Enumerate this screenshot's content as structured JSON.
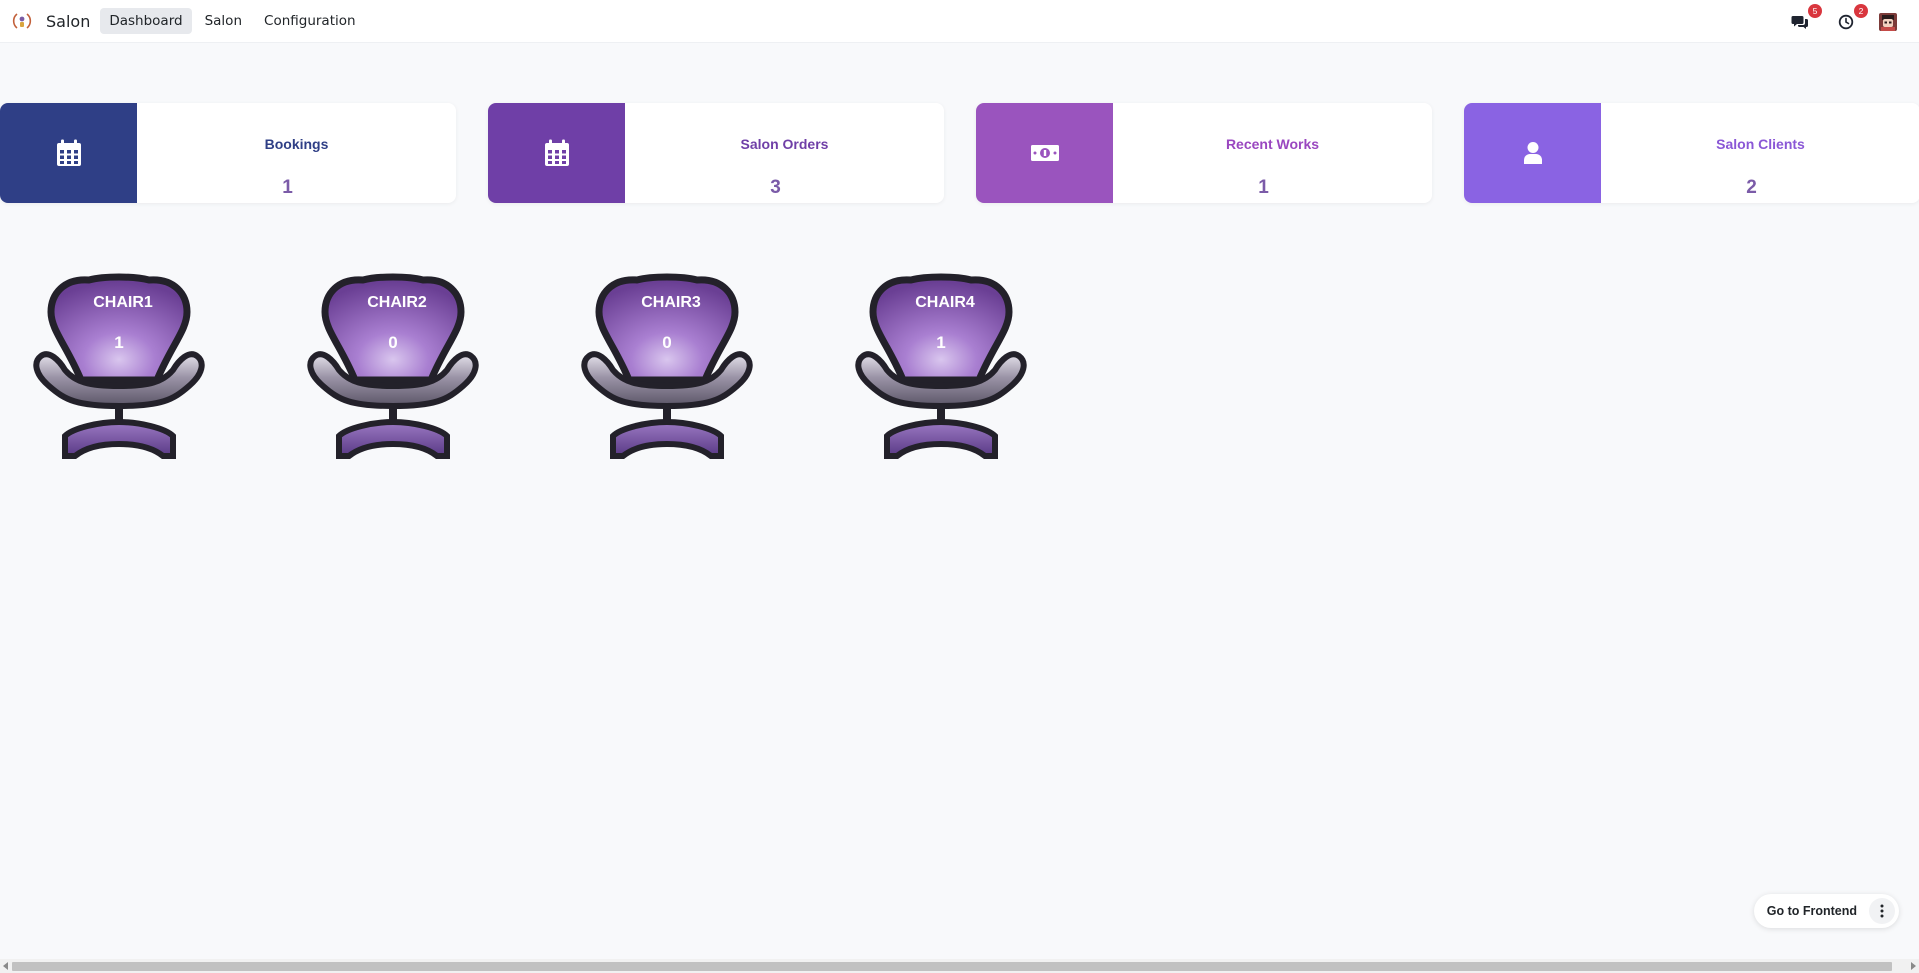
{
  "app": {
    "brand": "Salon"
  },
  "nav": {
    "items": [
      {
        "label": "Dashboard",
        "active": true
      },
      {
        "label": "Salon",
        "active": false
      },
      {
        "label": "Configuration",
        "active": false
      }
    ]
  },
  "systray": {
    "messages_badge": "5",
    "activities_badge": "2",
    "messages_icon": "chat-icon",
    "activities_icon": "clock-icon",
    "avatar_icon": "user-avatar"
  },
  "cards": [
    {
      "title": "Bookings",
      "count": "1",
      "icon": "calendar-icon",
      "color": "#2f3f86",
      "title_color": "#2f3f86"
    },
    {
      "title": "Salon Orders",
      "count": "3",
      "icon": "calendar-icon",
      "color": "#6f3fa7",
      "title_color": "#6f3fa7"
    },
    {
      "title": "Recent Works",
      "count": "1",
      "icon": "money-icon",
      "color": "#9a54be",
      "title_color": "#9a47c0"
    },
    {
      "title": "Salon Clients",
      "count": "2",
      "icon": "user-icon",
      "color": "#8a63e3",
      "title_color": "#8a57d6"
    }
  ],
  "chairs": [
    {
      "name": "CHAIR1",
      "count": "1"
    },
    {
      "name": "CHAIR2",
      "count": "0"
    },
    {
      "name": "CHAIR3",
      "count": "0"
    },
    {
      "name": "CHAIR4",
      "count": "1"
    }
  ],
  "footer": {
    "frontend_label": "Go to Frontend"
  },
  "colors": {
    "chair_purple": "#7e55a6",
    "count_purple": "#7b5ba8"
  }
}
